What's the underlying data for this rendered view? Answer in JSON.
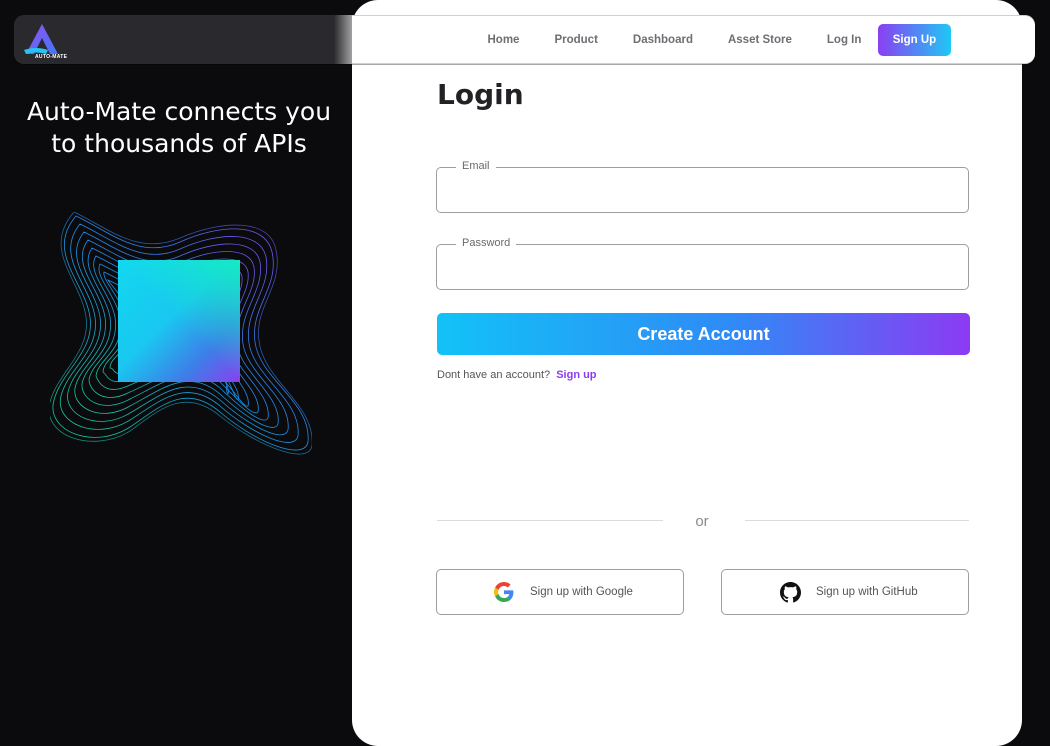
{
  "brand": {
    "logo_text": "AUTO-MATE"
  },
  "nav": {
    "items": [
      {
        "label": "Home"
      },
      {
        "label": "Product"
      },
      {
        "label": "Dashboard"
      },
      {
        "label": "Asset Store"
      },
      {
        "label": "Log In"
      }
    ],
    "signup_label": "Sign Up"
  },
  "promo": {
    "headline_line1": "Auto-Mate connects you",
    "headline_line2": "to thousands of APIs"
  },
  "login": {
    "title": "Login",
    "email_label": "Email",
    "email_value": "",
    "password_label": "Password",
    "password_value": "",
    "submit_label": "Create Account",
    "hint_text": "Dont have an account?",
    "hint_link": "Sign up",
    "divider_text": "or",
    "google_label": "Sign up with Google",
    "github_label": "Sign up with GitHub"
  },
  "colors": {
    "accent_purple": "#8b3ff2",
    "accent_cyan": "#1ec8f5",
    "background": "#0b0b0d"
  }
}
